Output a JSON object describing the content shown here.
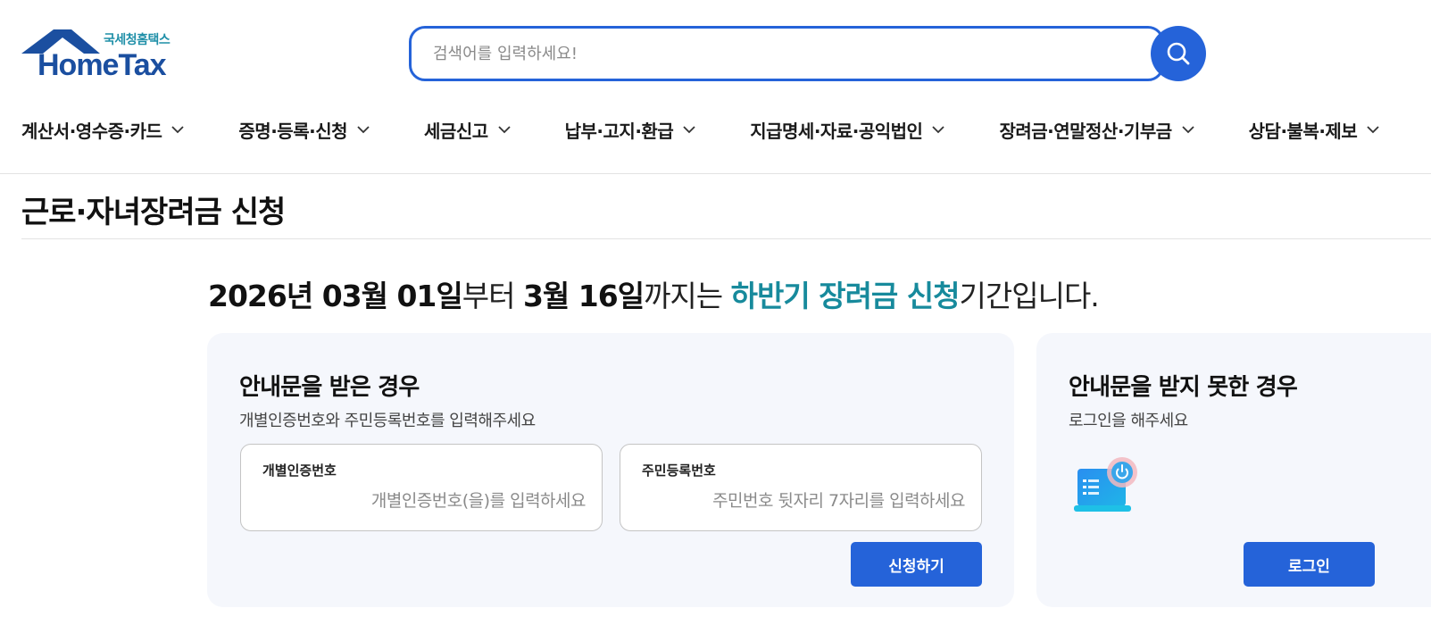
{
  "header": {
    "logo_sub": "국세청홈택스",
    "logo_main": "HomeTax",
    "search_placeholder": "검색어를 입력하세요!",
    "search_icon": "search-icon"
  },
  "nav": {
    "items": [
      {
        "label": "계산서·영수증·카드"
      },
      {
        "label": "증명·등록·신청"
      },
      {
        "label": "세금신고"
      },
      {
        "label": "납부·고지·환급"
      },
      {
        "label": "지급명세·자료·공익법인"
      },
      {
        "label": "장려금·연말정산·기부금"
      },
      {
        "label": "상담·불복·제보"
      }
    ]
  },
  "page": {
    "title": "근로·자녀장려금 신청"
  },
  "notice": {
    "start_date": "2026년 03월 01일",
    "from": "부터 ",
    "end_date": "3월 16일",
    "until": "까지는 ",
    "highlight": "하반기 장려금 신청",
    "suffix": "기간입니다."
  },
  "received": {
    "title": "안내문을 받은 경우",
    "desc": "개별인증번호와 주민등록번호를 입력해주세요",
    "auth_label": "개별인증번호",
    "auth_placeholder": "개별인증번호(을)를 입력하세요",
    "rrn_label": "주민등록번호",
    "rrn_placeholder": "주민번호 뒷자리 7자리를 입력하세요",
    "apply_button": "신청하기"
  },
  "not_received": {
    "title": "안내문을 받지 못한 경우",
    "desc": "로그인을 해주세요",
    "illustration_icon": "laptop-power-icon",
    "login_button": "로그인"
  },
  "colors": {
    "primary": "#2563d9",
    "highlight": "#178a9c",
    "card_bg": "#f5f7fc"
  }
}
